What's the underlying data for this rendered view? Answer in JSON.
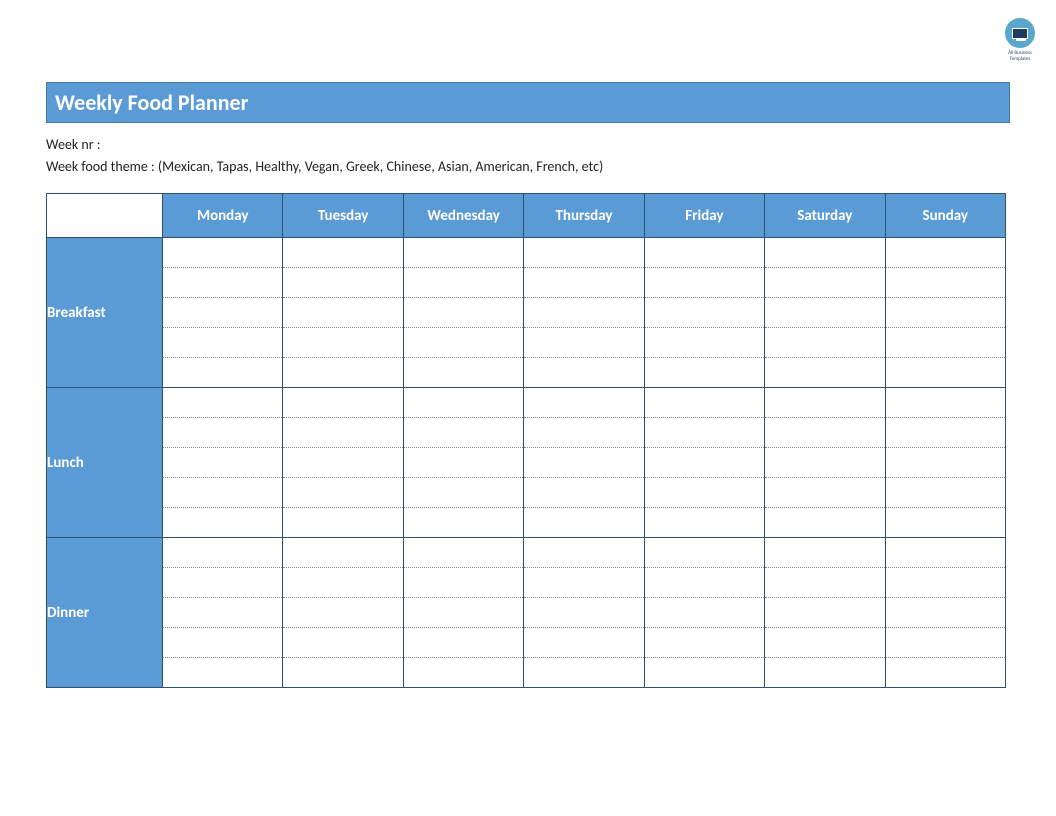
{
  "logo": {
    "text": "All Business Templates"
  },
  "title": "Weekly Food Planner",
  "meta": {
    "week_nr_label": "Week nr :",
    "week_nr_value": "",
    "theme_label": "Week food theme :",
    "theme_hint": "(Mexican, Tapas, Healthy, Vegan, Greek, Chinese, Asian, American, French, etc)"
  },
  "days": [
    "Monday",
    "Tuesday",
    "Wednesday",
    "Thursday",
    "Friday",
    "Saturday",
    "Sunday"
  ],
  "meals": [
    "Breakfast",
    "Lunch",
    "Dinner"
  ],
  "cells": {
    "Breakfast": {
      "Monday": "",
      "Tuesday": "",
      "Wednesday": "",
      "Thursday": "",
      "Friday": "",
      "Saturday": "",
      "Sunday": ""
    },
    "Lunch": {
      "Monday": "",
      "Tuesday": "",
      "Wednesday": "",
      "Thursday": "",
      "Friday": "",
      "Saturday": "",
      "Sunday": ""
    },
    "Dinner": {
      "Monday": "",
      "Tuesday": "",
      "Wednesday": "",
      "Thursday": "",
      "Friday": "",
      "Saturday": "",
      "Sunday": ""
    }
  },
  "colors": {
    "accent": "#5b9bd5",
    "border": "#2f5170"
  }
}
